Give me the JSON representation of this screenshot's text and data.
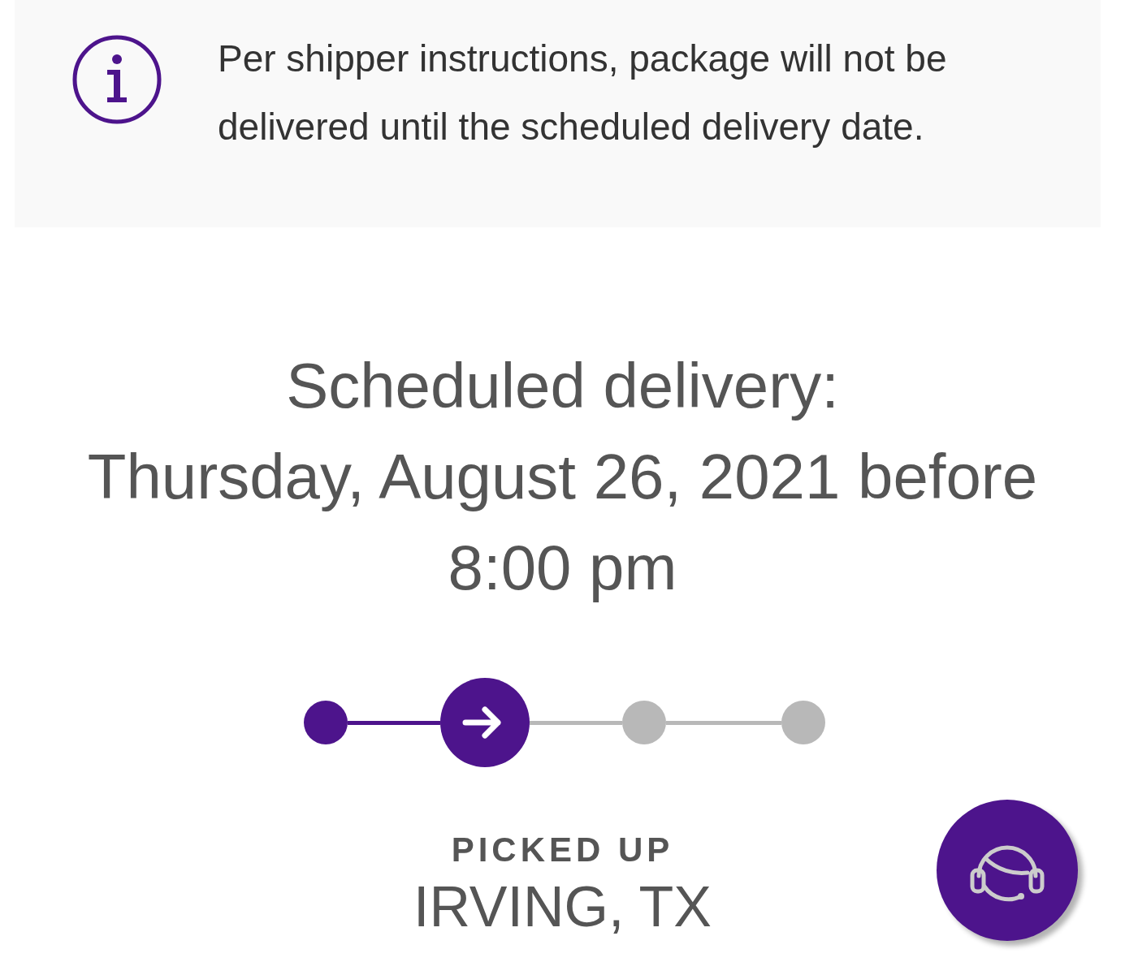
{
  "notice": {
    "text": "Per shipper instructions, package will not be delivered until the scheduled delivery date."
  },
  "delivery": {
    "heading": "Scheduled delivery:",
    "date": "Thursday, August 26, 2021 before 8:00 pm"
  },
  "progress": [
    {
      "done": true,
      "selected": false
    },
    {
      "done": true,
      "selected": true
    },
    {
      "done": false,
      "selected": false
    },
    {
      "done": false,
      "selected": false
    }
  ],
  "status": {
    "label": "PICKED UP",
    "location": "IRVING, TX"
  }
}
